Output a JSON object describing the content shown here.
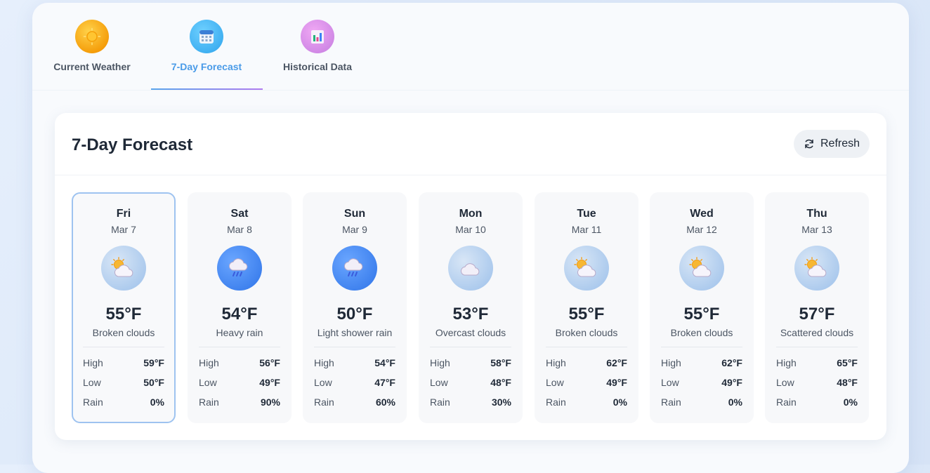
{
  "tabs": [
    {
      "label": "Current Weather",
      "icon": "sun-icon",
      "active": false
    },
    {
      "label": "7-Day Forecast",
      "icon": "calendar-icon",
      "active": true
    },
    {
      "label": "Historical Data",
      "icon": "bar-chart-icon",
      "active": false
    }
  ],
  "panel": {
    "title": "7-Day Forecast",
    "refresh_label": "Refresh",
    "refresh_icon": "refresh-icon"
  },
  "labels": {
    "high": "High",
    "low": "Low",
    "rain": "Rain"
  },
  "forecast": [
    {
      "day": "Fri",
      "date": "Mar 7",
      "temp": "55°F",
      "desc": "Broken clouds",
      "icon": "partly-cloudy-icon",
      "high": "59°F",
      "low": "50°F",
      "rain": "0%",
      "selected": true
    },
    {
      "day": "Sat",
      "date": "Mar 8",
      "temp": "54°F",
      "desc": "Heavy rain",
      "icon": "rain-cloud-icon",
      "high": "56°F",
      "low": "49°F",
      "rain": "90%",
      "selected": false
    },
    {
      "day": "Sun",
      "date": "Mar 9",
      "temp": "50°F",
      "desc": "Light shower rain",
      "icon": "rain-cloud-icon",
      "high": "54°F",
      "low": "47°F",
      "rain": "60%",
      "selected": false
    },
    {
      "day": "Mon",
      "date": "Mar 10",
      "temp": "53°F",
      "desc": "Overcast clouds",
      "icon": "cloud-icon",
      "high": "58°F",
      "low": "48°F",
      "rain": "30%",
      "selected": false
    },
    {
      "day": "Tue",
      "date": "Mar 11",
      "temp": "55°F",
      "desc": "Broken clouds",
      "icon": "partly-cloudy-icon",
      "high": "62°F",
      "low": "49°F",
      "rain": "0%",
      "selected": false
    },
    {
      "day": "Wed",
      "date": "Mar 12",
      "temp": "55°F",
      "desc": "Broken clouds",
      "icon": "partly-cloudy-icon",
      "high": "62°F",
      "low": "49°F",
      "rain": "0%",
      "selected": false
    },
    {
      "day": "Thu",
      "date": "Mar 13",
      "temp": "57°F",
      "desc": "Scattered clouds",
      "icon": "partly-cloudy-icon",
      "high": "65°F",
      "low": "48°F",
      "rain": "0%",
      "selected": false
    }
  ],
  "colors": {
    "accent": "#4a9be8",
    "accent_gradient_end": "#b07cf0",
    "selected_border": "#9ec3f0"
  }
}
